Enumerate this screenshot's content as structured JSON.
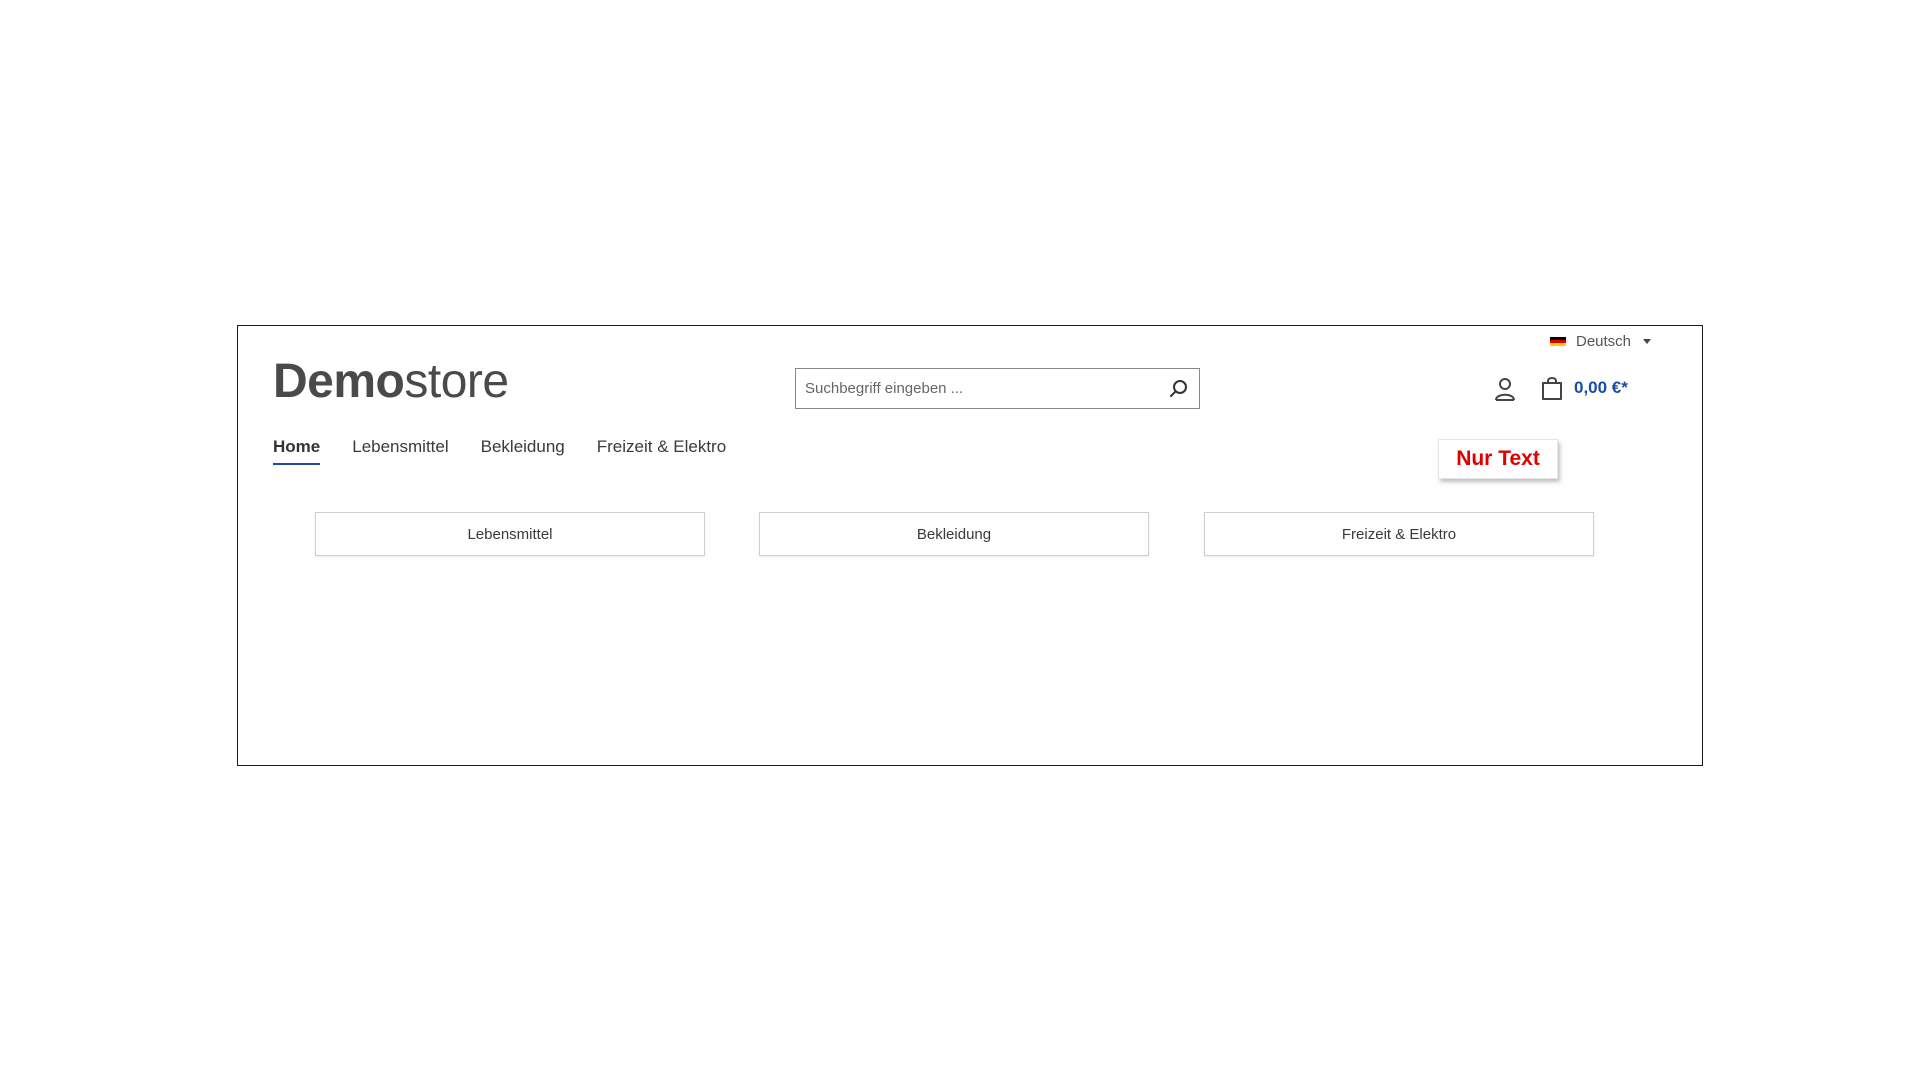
{
  "language": {
    "label": "Deutsch",
    "flag_colors": [
      "#000000",
      "#dd0000",
      "#ffce00"
    ]
  },
  "logo": {
    "bold": "Demo",
    "light": "store"
  },
  "search": {
    "placeholder": "Suchbegriff eingeben ...",
    "value": "",
    "icon": "search-icon"
  },
  "header": {
    "account_icon": "user-icon",
    "cart_icon": "shopping-bag-icon",
    "cart_total": "0,00 €*"
  },
  "nav": {
    "items": [
      {
        "label": "Home",
        "active": true
      },
      {
        "label": "Lebensmittel",
        "active": false
      },
      {
        "label": "Bekleidung",
        "active": false
      },
      {
        "label": "Freizeit & Elektro",
        "active": false
      }
    ]
  },
  "annotation": {
    "label": "Nur Text",
    "color": "#e00000"
  },
  "categories": [
    {
      "label": "Lebensmittel"
    },
    {
      "label": "Bekleidung"
    },
    {
      "label": "Freizeit & Elektro"
    }
  ],
  "colors": {
    "accent": "#1a4ca1",
    "text": "#3a3a3a"
  }
}
